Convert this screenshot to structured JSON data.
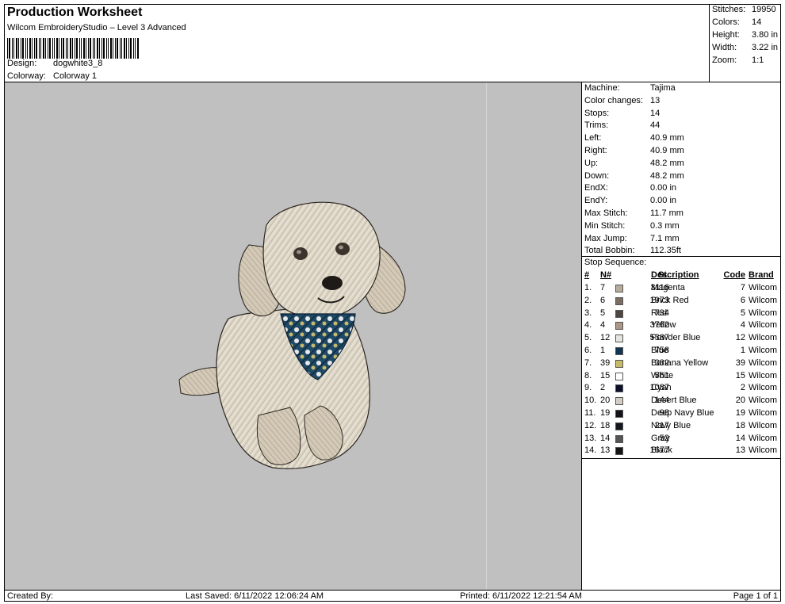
{
  "header": {
    "title": "Production Worksheet",
    "subtitle": "Wilcom EmbroideryStudio – Level 3 Advanced",
    "design_label": "Design:",
    "design_value": "dogwhite3_8",
    "colorway_label": "Colorway:",
    "colorway_value": "Colorway 1"
  },
  "stats": {
    "stitches_label": "Stitches:",
    "stitches_value": "19950",
    "colors_label": "Colors:",
    "colors_value": "14",
    "height_label": "Height:",
    "height_value": "3.80 in",
    "width_label": "Width:",
    "width_value": "3.22 in",
    "zoom_label": "Zoom:",
    "zoom_value": "1:1"
  },
  "machine_info": [
    {
      "label": "Machine:",
      "value": "Tajima"
    },
    {
      "label": "Color changes:",
      "value": "13"
    },
    {
      "label": "Stops:",
      "value": "14"
    },
    {
      "label": "Trims:",
      "value": "44"
    },
    {
      "label": "Left:",
      "value": "40.9 mm"
    },
    {
      "label": "Right:",
      "value": "40.9 mm"
    },
    {
      "label": "Up:",
      "value": "48.2 mm"
    },
    {
      "label": "Down:",
      "value": "48.2 mm"
    },
    {
      "label": "EndX:",
      "value": "0.00 in"
    },
    {
      "label": "EndY:",
      "value": "0.00 in"
    },
    {
      "label": "Max Stitch:",
      "value": "11.7 mm"
    },
    {
      "label": "Min Stitch:",
      "value": "0.3 mm"
    },
    {
      "label": "Max Jump:",
      "value": "7.1 mm"
    },
    {
      "label": "Total Bobbin:",
      "value": "112.35ft"
    }
  ],
  "stop_sequence": {
    "title": "Stop Sequence:",
    "headers": {
      "num": "#",
      "n": "N#",
      "st": "St.",
      "description": "Description",
      "code": "Code",
      "brand": "Brand"
    },
    "rows": [
      {
        "num": "1.",
        "n": "7",
        "color": "#b8ab9b",
        "st": "3116",
        "description": "Magenta",
        "code": "7",
        "brand": "Wilcom"
      },
      {
        "num": "2.",
        "n": "6",
        "color": "#7a6d62",
        "st": "1973",
        "description": "Brick Red",
        "code": "6",
        "brand": "Wilcom"
      },
      {
        "num": "3.",
        "n": "5",
        "color": "#4f4642",
        "st": "734",
        "description": "Red",
        "code": "5",
        "brand": "Wilcom"
      },
      {
        "num": "4.",
        "n": "4",
        "color": "#a9988a",
        "st": "3762",
        "description": "Yellow",
        "code": "4",
        "brand": "Wilcom"
      },
      {
        "num": "5.",
        "n": "12",
        "color": "#e6e4e0",
        "st": "5387",
        "description": "Powder Blue",
        "code": "12",
        "brand": "Wilcom"
      },
      {
        "num": "6.",
        "n": "1",
        "color": "#123551",
        "st": "758",
        "description": "Blue",
        "code": "1",
        "brand": "Wilcom"
      },
      {
        "num": "7.",
        "n": "39",
        "color": "#c8b96a",
        "st": "382",
        "description": "Banana Yellow",
        "code": "39",
        "brand": "Wilcom"
      },
      {
        "num": "8.",
        "n": "15",
        "color": "#ffffff",
        "st": "561",
        "description": "White",
        "code": "15",
        "brand": "Wilcom"
      },
      {
        "num": "9.",
        "n": "2",
        "color": "#0c0f2a",
        "st": "1087",
        "description": "Cyan",
        "code": "2",
        "brand": "Wilcom"
      },
      {
        "num": "10.",
        "n": "20",
        "color": "#d2cdc4",
        "st": "144",
        "description": "Desert Blue",
        "code": "20",
        "brand": "Wilcom"
      },
      {
        "num": "11.",
        "n": "19",
        "color": "#111318",
        "st": "98",
        "description": "Deep Navy Blue",
        "code": "19",
        "brand": "Wilcom"
      },
      {
        "num": "12.",
        "n": "18",
        "color": "#14171d",
        "st": "217",
        "description": "Navy Blue",
        "code": "18",
        "brand": "Wilcom"
      },
      {
        "num": "13.",
        "n": "14",
        "color": "#555555",
        "st": "52",
        "description": "Grey",
        "code": "14",
        "brand": "Wilcom"
      },
      {
        "num": "14.",
        "n": "13",
        "color": "#151515",
        "st": "1677",
        "description": "Black",
        "code": "13",
        "brand": "Wilcom"
      }
    ]
  },
  "footer": {
    "created_by": "Created By:",
    "last_saved": "Last Saved: 6/11/2022 12:06:24 AM",
    "printed": "Printed: 6/11/2022 12:21:54 AM",
    "page": "Page 1 of 1"
  }
}
